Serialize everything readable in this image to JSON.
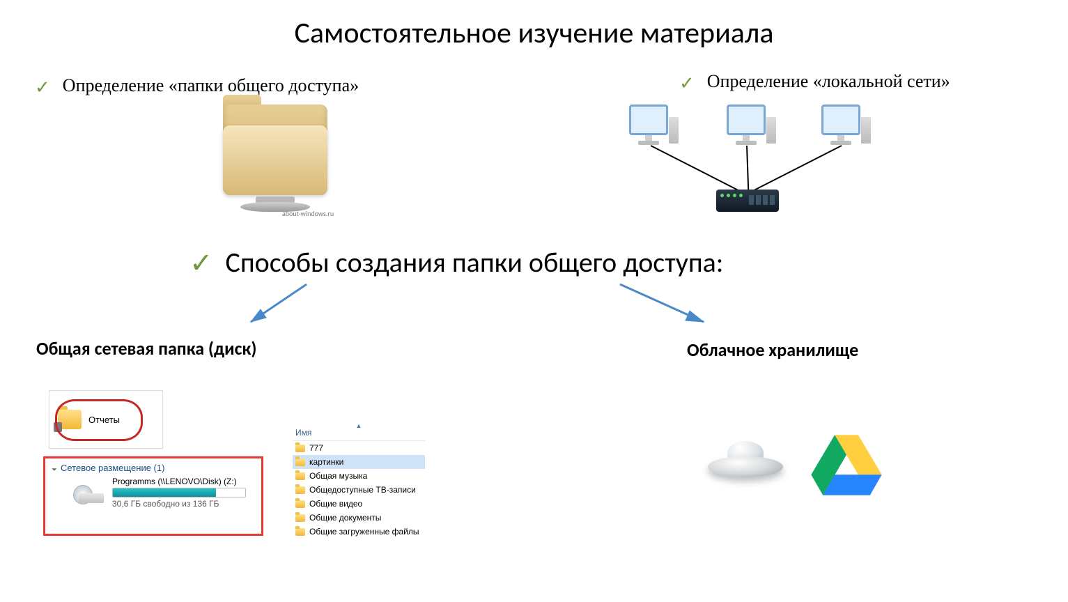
{
  "title": "Самостоятельное изучение материала",
  "bullets": {
    "shared_folder_def": "Определение «папки общего доступа»",
    "lan_def": "Определение «локальной сети»",
    "ways": "Способы создания папки общего доступа:"
  },
  "folder_credit": "about-windows.ru",
  "subheads": {
    "network_share": "Общая сетевая папка (диск)",
    "cloud": "Облачное хранилище"
  },
  "share_folder_label": "Отчеты",
  "netloc": {
    "header": "Сетевое размещение (1)",
    "drive_name": "Programms (\\\\LENOVO\\Disk) (Z:)",
    "drive_free": "30,6 ГБ свободно из 136 ГБ"
  },
  "filelist": {
    "header": "Имя",
    "items": [
      "777",
      "картинки",
      "Общая музыка",
      "Общедоступные ТВ-записи",
      "Общие видео",
      "Общие документы",
      "Общие загруженные файлы"
    ],
    "selected_index": 1
  },
  "icons": {
    "check": "checkmark-icon",
    "folder": "shared-folder-icon",
    "network": "lan-topology-icon",
    "ufo": "yandex-disk-ufo-icon",
    "gdrive": "google-drive-icon"
  },
  "colors": {
    "check": "#6f9a3e",
    "arrow": "#4a89c7",
    "highlight_red": "#e53935"
  }
}
